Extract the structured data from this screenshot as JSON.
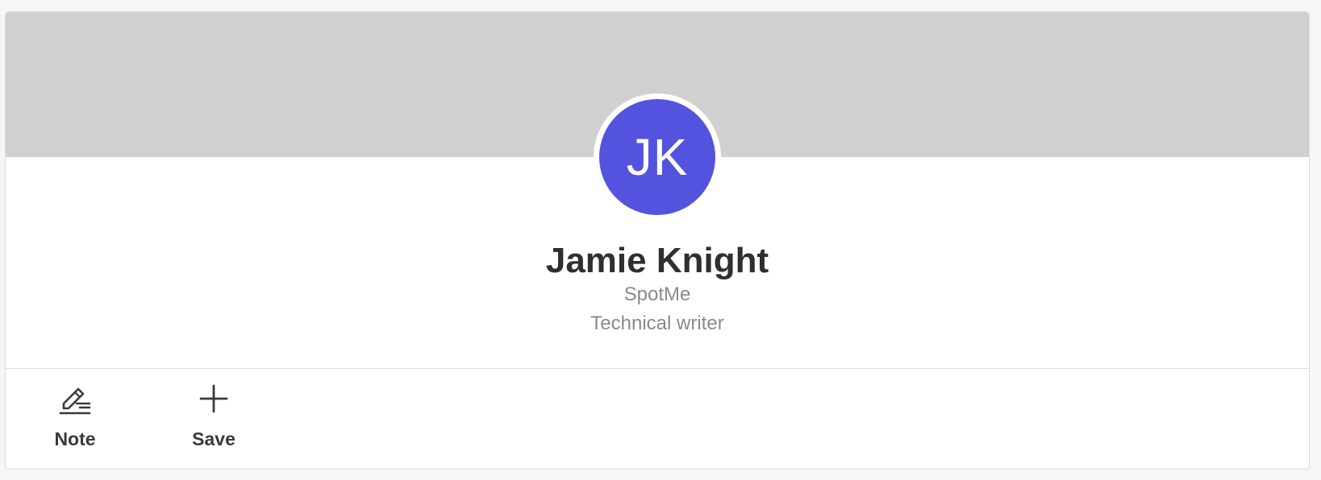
{
  "profile": {
    "initials": "JK",
    "name": "Jamie Knight",
    "company": "SpotMe",
    "role": "Technical writer",
    "avatar_color": "#5353e0",
    "cover_color": "#d0d0d0"
  },
  "actions": [
    {
      "label": "Note",
      "icon": "edit-note-icon"
    },
    {
      "label": "Save",
      "icon": "plus-icon"
    }
  ]
}
